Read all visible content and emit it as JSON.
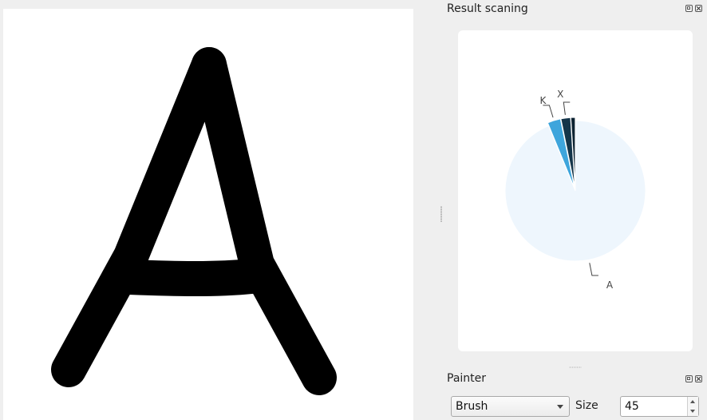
{
  "canvas": {
    "background": "#ffffff",
    "stroke_color": "#000000",
    "drawn_character": "A"
  },
  "result_dock": {
    "title": "Result scaning",
    "buttons": [
      "float-icon",
      "close-icon"
    ]
  },
  "chart_data": {
    "type": "pie",
    "slices": [
      {
        "label": "A",
        "value": 93.8,
        "color": "#eef6fd"
      },
      {
        "label": "K",
        "value": 3.0,
        "color": "#3ea5dc"
      },
      {
        "label": "X",
        "value": 2.2,
        "color": "#14354a"
      },
      {
        "label": "",
        "value": 1.0,
        "color": "#0b2231"
      }
    ]
  },
  "painter_dock": {
    "title": "Painter",
    "tool_select": {
      "value": "Brush"
    },
    "size_label": "Size",
    "size_value": "45"
  }
}
